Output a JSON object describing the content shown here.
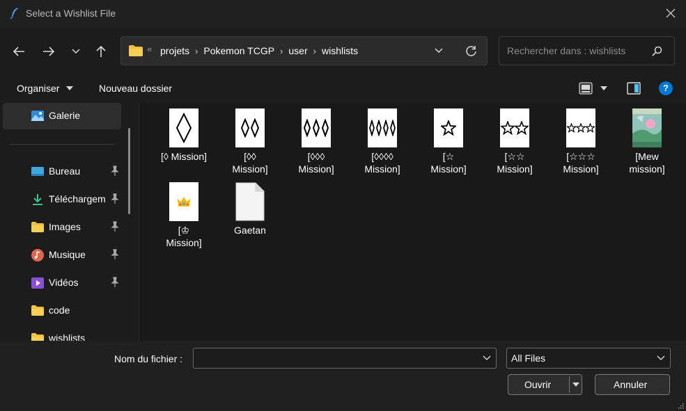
{
  "window": {
    "title": "Select a Wishlist File"
  },
  "nav": {
    "breadcrumb": [
      "projets",
      "Pokemon TCGP",
      "user",
      "wishlists"
    ],
    "overflow": "«",
    "search_placeholder": "Rechercher dans : wishlists"
  },
  "toolbar": {
    "organize": "Organiser",
    "new_folder": "Nouveau dossier",
    "help": "?"
  },
  "sidebar": {
    "items": [
      {
        "label": "Galerie",
        "icon": "gallery-icon"
      },
      {
        "label": "Bureau",
        "icon": "desktop-icon",
        "pinned": true
      },
      {
        "label": "Téléchargem",
        "icon": "download-icon",
        "pinned": true
      },
      {
        "label": "Images",
        "icon": "images-folder-icon",
        "pinned": true
      },
      {
        "label": "Musique",
        "icon": "music-icon",
        "pinned": true
      },
      {
        "label": "Vidéos",
        "icon": "videos-icon",
        "pinned": true
      },
      {
        "label": "code",
        "icon": "folder-icon"
      },
      {
        "label": "wishlists",
        "icon": "folder-icon"
      }
    ]
  },
  "files": [
    {
      "name": "[◊ Mission]",
      "icon": "diamond-1-icon"
    },
    {
      "name": "[◊◊\nMission]",
      "icon": "diamond-2-icon"
    },
    {
      "name": "[◊◊◊\nMission]",
      "icon": "diamond-3-icon"
    },
    {
      "name": "[◊◊◊◊\nMission]",
      "icon": "diamond-4-icon"
    },
    {
      "name": "[☆\nMission]",
      "icon": "star-1-icon"
    },
    {
      "name": "[☆☆\nMission]",
      "icon": "star-2-icon"
    },
    {
      "name": "[☆☆☆\nMission]",
      "icon": "star-3-icon"
    },
    {
      "name": "[Mew\nmission]",
      "icon": "mew-card-icon"
    },
    {
      "name": "[♔\nMission]",
      "icon": "crown-icon"
    },
    {
      "name": "Gaetan",
      "icon": "blank-file-icon"
    }
  ],
  "footer": {
    "filename_label": "Nom du fichier :",
    "filename_value": "",
    "filetype_value": "All Files",
    "open_label": "Ouvrir",
    "cancel_label": "Annuler"
  },
  "colors": {
    "accent": "#0078d4",
    "folder": "#f3c03b",
    "background": "#191919"
  }
}
